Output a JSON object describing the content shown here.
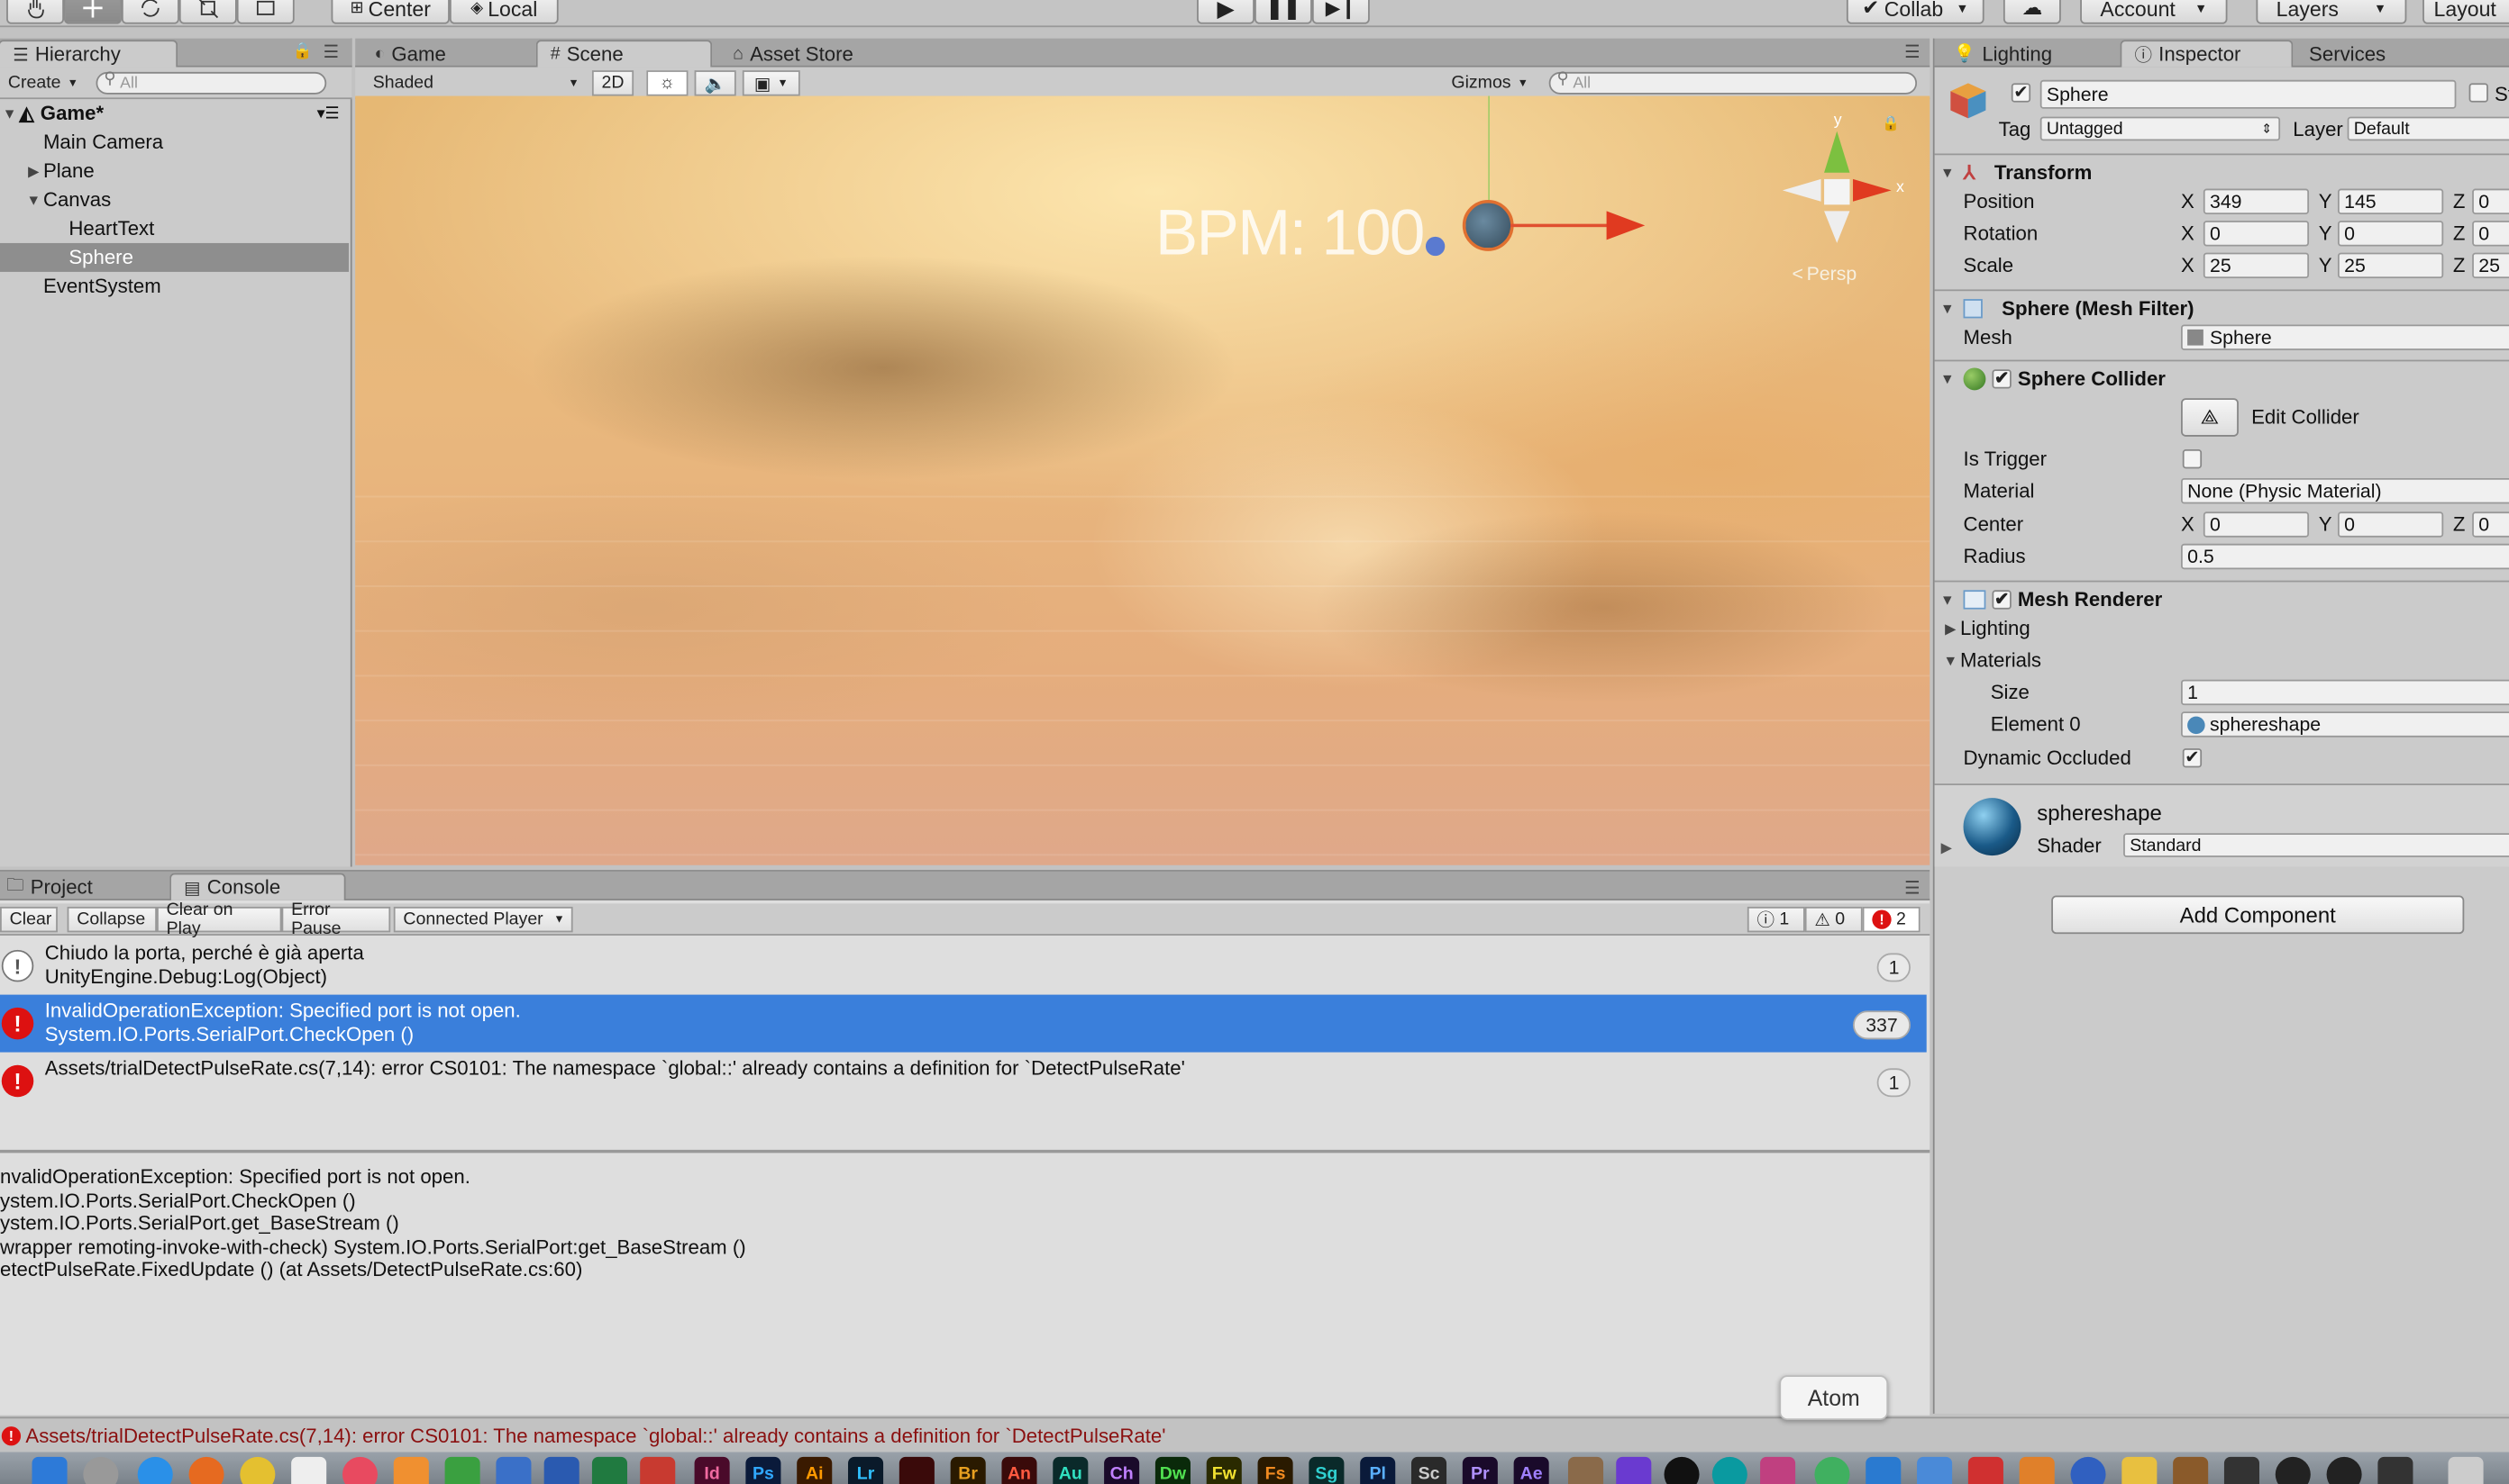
{
  "toolbar": {
    "center": "Center",
    "local": "Local",
    "collab": "Collab",
    "account": "Account",
    "layers": "Layers",
    "layout": "Layout"
  },
  "hierarchy": {
    "tab": "Hierarchy",
    "create": "Create",
    "search_placeholder": "All",
    "scene": "Game*",
    "items": [
      {
        "label": "Main Camera"
      },
      {
        "label": "Plane"
      },
      {
        "label": "Canvas"
      },
      {
        "label": "HeartText"
      },
      {
        "label": "Sphere"
      },
      {
        "label": "EventSystem"
      }
    ]
  },
  "scene_panel": {
    "tabs": {
      "game": "Game",
      "scene": "Scene",
      "asset_store": "Asset Store"
    },
    "shading": "Shaded",
    "mode_2d": "2D",
    "gizmos": "Gizmos",
    "search_placeholder": "All",
    "bpm_text": "BPM: 100",
    "persp": "Persp",
    "axis_y": "y",
    "axis_x": "x"
  },
  "inspector": {
    "tabs": {
      "lighting": "Lighting",
      "inspector": "Inspector",
      "services": "Services"
    },
    "object_name": "Sphere",
    "static_label": "St",
    "tag_label": "Tag",
    "tag_value": "Untagged",
    "layer_label": "Layer",
    "layer_value": "Default",
    "transform": {
      "title": "Transform",
      "position_label": "Position",
      "rotation_label": "Rotation",
      "scale_label": "Scale",
      "x": "X",
      "y": "Y",
      "z": "Z",
      "position": {
        "x": "349",
        "y": "145",
        "z": "0"
      },
      "rotation": {
        "x": "0",
        "y": "0",
        "z": "0"
      },
      "scale": {
        "x": "25",
        "y": "25",
        "z": "25"
      }
    },
    "mesh_filter": {
      "title": "Sphere (Mesh Filter)",
      "mesh_label": "Mesh",
      "mesh_value": "Sphere"
    },
    "sphere_collider": {
      "title": "Sphere Collider",
      "edit_collider": "Edit Collider",
      "is_trigger": "Is Trigger",
      "material_label": "Material",
      "material_value": "None (Physic Material)",
      "center_label": "Center",
      "center": {
        "x": "0",
        "y": "0",
        "z": "0"
      },
      "radius_label": "Radius",
      "radius": "0.5"
    },
    "mesh_renderer": {
      "title": "Mesh Renderer",
      "lighting": "Lighting",
      "materials": "Materials",
      "size_label": "Size",
      "size": "1",
      "element0_label": "Element 0",
      "element0": "sphereshape",
      "dynamic_occluded": "Dynamic Occluded"
    },
    "material": {
      "name": "sphereshape",
      "shader_label": "Shader",
      "shader_value": "Standard"
    },
    "add_component": "Add Component"
  },
  "console": {
    "tabs": {
      "project": "Project",
      "console": "Console"
    },
    "buttons": {
      "clear": "Clear",
      "collapse": "Collapse",
      "clear_on_play": "Clear on Play",
      "error_pause": "Error Pause",
      "connected_player": "Connected Player"
    },
    "counts": {
      "info": "1",
      "warning": "0",
      "error": "2"
    },
    "entries": [
      {
        "line1": "Chiudo la porta, perché è già aperta",
        "line2": "UnityEngine.Debug:Log(Object)",
        "count": "1"
      },
      {
        "line1": "InvalidOperationException: Specified port is not open.",
        "line2": "System.IO.Ports.SerialPort.CheckOpen ()",
        "count": "337"
      },
      {
        "line1": "Assets/trialDetectPulseRate.cs(7,14): error CS0101: The namespace `global::' already contains a definition for `DetectPulseRate'",
        "line2": "",
        "count": "1"
      }
    ],
    "detail": [
      "nvalidOperationException: Specified port is not open.",
      "ystem.IO.Ports.SerialPort.CheckOpen ()",
      "ystem.IO.Ports.SerialPort.get_BaseStream ()",
      "wrapper remoting-invoke-with-check) System.IO.Ports.SerialPort:get_BaseStream ()",
      "etectPulseRate.FixedUpdate () (at Assets/DetectPulseRate.cs:60)"
    ],
    "status": "Assets/trialDetectPulseRate.cs(7,14): error CS0101: The namespace `global::' already contains a definition for `DetectPulseRate'"
  },
  "tooltip": "Atom",
  "dock": {
    "apps": [
      "Id",
      "Ps",
      "Ai",
      "Lr",
      "",
      "Br",
      "An",
      "Au",
      "Ch",
      "Dw",
      "Fw",
      "Fs",
      "Sg",
      "Pl",
      "Sc",
      "Pr",
      "Ae"
    ]
  }
}
